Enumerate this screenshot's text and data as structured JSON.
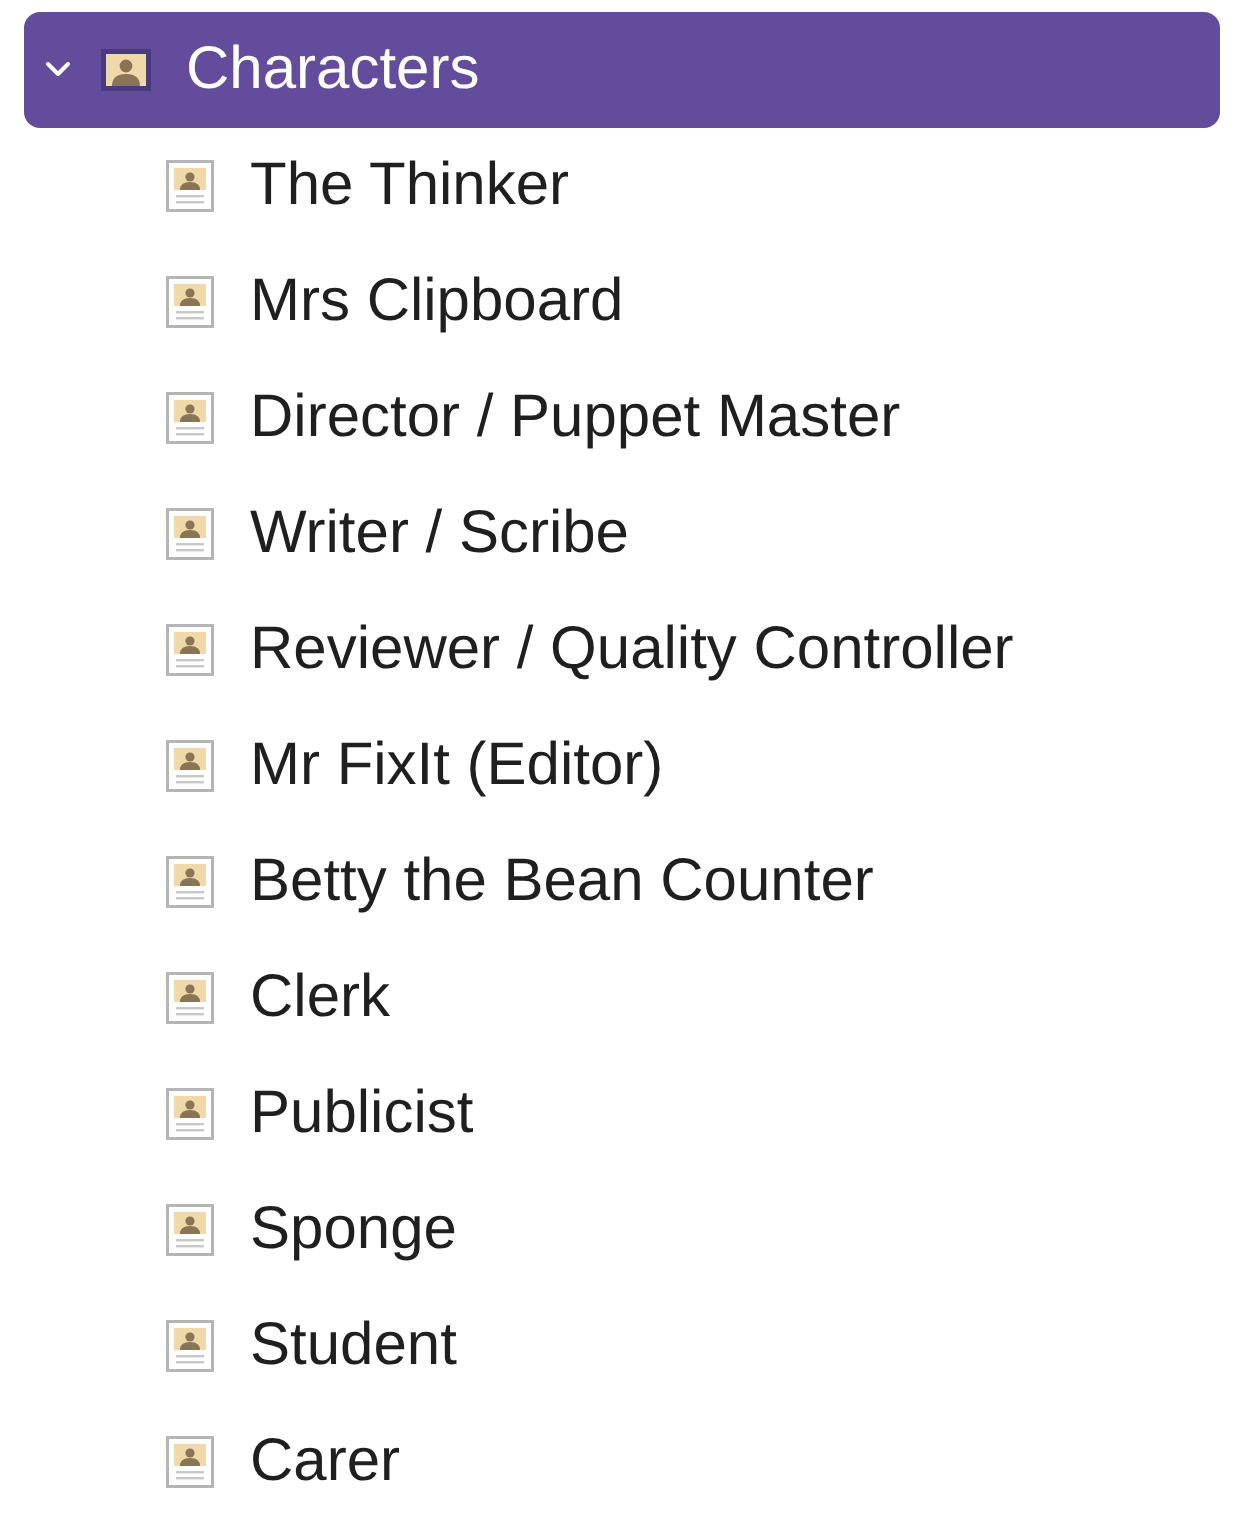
{
  "tree": {
    "label": "Characters",
    "expanded": true,
    "selected": true,
    "children": [
      {
        "label": "The Thinker",
        "selected": false
      },
      {
        "label": "Mrs Clipboard",
        "selected": false
      },
      {
        "label": "Director / Puppet Master",
        "selected": false
      },
      {
        "label": "Writer / Scribe",
        "selected": false
      },
      {
        "label": "Reviewer / Quality Controller",
        "selected": false
      },
      {
        "label": "Mr FixIt (Editor)",
        "selected": false
      },
      {
        "label": "Betty the Bean Counter",
        "selected": false
      },
      {
        "label": "Clerk",
        "selected": false
      },
      {
        "label": "Publicist",
        "selected": false
      },
      {
        "label": "Sponge",
        "selected": false
      },
      {
        "label": "Student",
        "selected": false
      },
      {
        "label": "Carer",
        "selected": false
      }
    ]
  }
}
